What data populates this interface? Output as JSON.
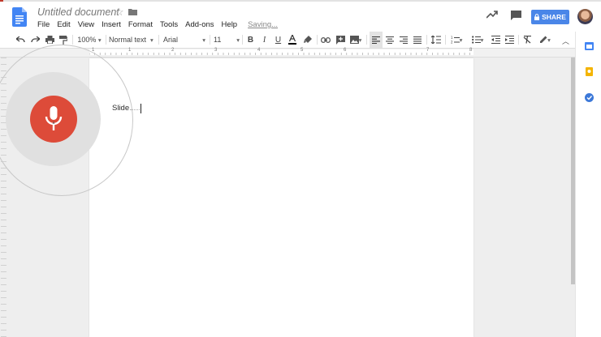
{
  "document": {
    "title": "Untitled document",
    "saving_status": "Saving..."
  },
  "menu": [
    "File",
    "Edit",
    "View",
    "Insert",
    "Format",
    "Tools",
    "Add-ons",
    "Help"
  ],
  "share": {
    "label": "SHARE"
  },
  "toolbar": {
    "zoom": "100%",
    "style": "Normal text",
    "font": "Arial",
    "size": "11"
  },
  "ruler": {
    "numbers": [
      "1",
      "1",
      "2",
      "3",
      "4",
      "5",
      "6",
      "7",
      "8"
    ]
  },
  "body": {
    "text": "Slide"
  },
  "colors": {
    "accent": "#4a86e8",
    "mic": "#dd4b39",
    "docs_blue": "#4285f4"
  },
  "icons": [
    "docs-logo-icon",
    "star-icon",
    "folder-icon",
    "activity-icon",
    "comment-icon",
    "lock-icon",
    "undo-icon",
    "redo-icon",
    "print-icon",
    "paint-format-icon",
    "bold-icon",
    "italic-icon",
    "underline-icon",
    "text-color-icon",
    "highlight-icon",
    "link-icon",
    "insert-comment-icon",
    "image-icon",
    "align-left-icon",
    "align-center-icon",
    "align-right-icon",
    "justify-icon",
    "line-spacing-icon",
    "numbered-list-icon",
    "bulleted-list-icon",
    "decrease-indent-icon",
    "increase-indent-icon",
    "clear-formatting-icon",
    "editing-mode-icon",
    "collapse-icon",
    "microphone-icon",
    "calendar-icon",
    "keep-icon",
    "tasks-icon"
  ]
}
